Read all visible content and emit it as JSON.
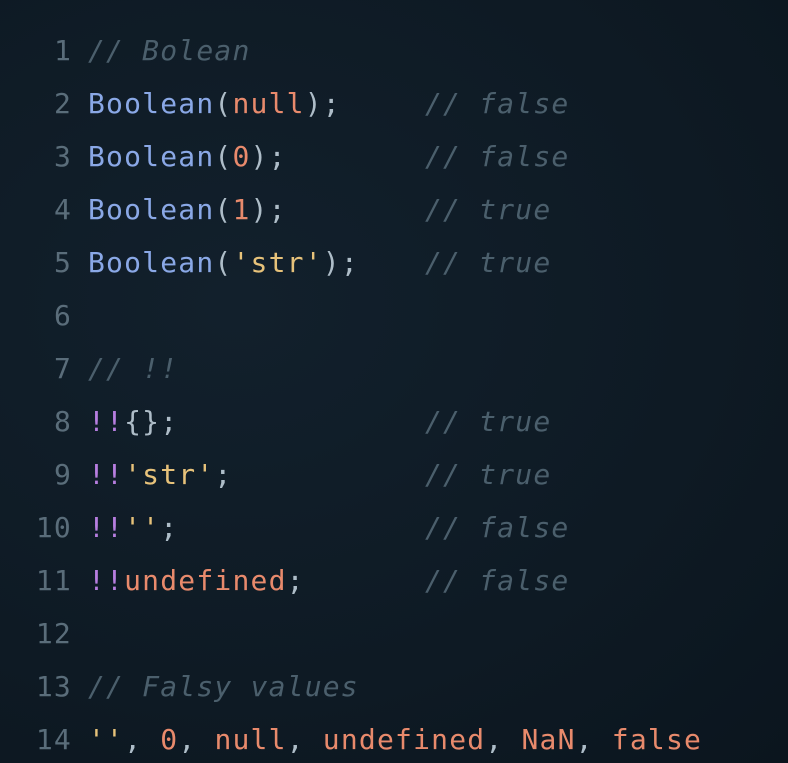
{
  "editor": {
    "colors": {
      "background": "#0f1b26",
      "line_number": "#5a6d7a",
      "comment": "#4b5f6c",
      "function": "#8aa8e6",
      "punctuation": "#aebdc8",
      "keyword": "#e88a6c",
      "string": "#e7c27a",
      "operator": "#b77ee0"
    },
    "lines": [
      {
        "n": "1",
        "parts": [
          {
            "t": "// Bolean",
            "c": "cmt"
          }
        ]
      },
      {
        "n": "2",
        "parts": [
          {
            "t": "Boolean",
            "c": "fn"
          },
          {
            "t": "(",
            "c": "punc"
          },
          {
            "t": "null",
            "c": "kw"
          },
          {
            "t": ");",
            "c": "punc"
          }
        ],
        "comment": "// false"
      },
      {
        "n": "3",
        "parts": [
          {
            "t": "Boolean",
            "c": "fn"
          },
          {
            "t": "(",
            "c": "punc"
          },
          {
            "t": "0",
            "c": "num"
          },
          {
            "t": ");",
            "c": "punc"
          }
        ],
        "comment": "// false"
      },
      {
        "n": "4",
        "parts": [
          {
            "t": "Boolean",
            "c": "fn"
          },
          {
            "t": "(",
            "c": "punc"
          },
          {
            "t": "1",
            "c": "num"
          },
          {
            "t": ");",
            "c": "punc"
          }
        ],
        "comment": "// true"
      },
      {
        "n": "5",
        "parts": [
          {
            "t": "Boolean",
            "c": "fn"
          },
          {
            "t": "(",
            "c": "punc"
          },
          {
            "t": "'str'",
            "c": "str"
          },
          {
            "t": ");",
            "c": "punc"
          }
        ],
        "comment": "// true"
      },
      {
        "n": "6",
        "parts": []
      },
      {
        "n": "7",
        "parts": [
          {
            "t": "// !!",
            "c": "cmt"
          }
        ]
      },
      {
        "n": "8",
        "parts": [
          {
            "t": "!!",
            "c": "op"
          },
          {
            "t": "{};",
            "c": "punc"
          }
        ],
        "comment": "// true"
      },
      {
        "n": "9",
        "parts": [
          {
            "t": "!!",
            "c": "op"
          },
          {
            "t": "'str'",
            "c": "str"
          },
          {
            "t": ";",
            "c": "punc"
          }
        ],
        "comment": "// true"
      },
      {
        "n": "10",
        "parts": [
          {
            "t": "!!",
            "c": "op"
          },
          {
            "t": "''",
            "c": "str"
          },
          {
            "t": ";",
            "c": "punc"
          }
        ],
        "comment": "// false"
      },
      {
        "n": "11",
        "parts": [
          {
            "t": "!!",
            "c": "op"
          },
          {
            "t": "undefined",
            "c": "kw"
          },
          {
            "t": ";",
            "c": "punc"
          }
        ],
        "comment": "// false"
      },
      {
        "n": "12",
        "parts": []
      },
      {
        "n": "13",
        "parts": [
          {
            "t": "// Falsy values",
            "c": "cmt"
          }
        ]
      },
      {
        "n": "14",
        "parts": [
          {
            "t": "''",
            "c": "str"
          },
          {
            "t": ", ",
            "c": "punc"
          },
          {
            "t": "0",
            "c": "num"
          },
          {
            "t": ", ",
            "c": "punc"
          },
          {
            "t": "null",
            "c": "kw"
          },
          {
            "t": ", ",
            "c": "punc"
          },
          {
            "t": "undefined",
            "c": "kw"
          },
          {
            "t": ", ",
            "c": "punc"
          },
          {
            "t": "NaN",
            "c": "kw"
          },
          {
            "t": ", ",
            "c": "punc"
          },
          {
            "t": "false",
            "c": "kw"
          }
        ]
      }
    ]
  }
}
